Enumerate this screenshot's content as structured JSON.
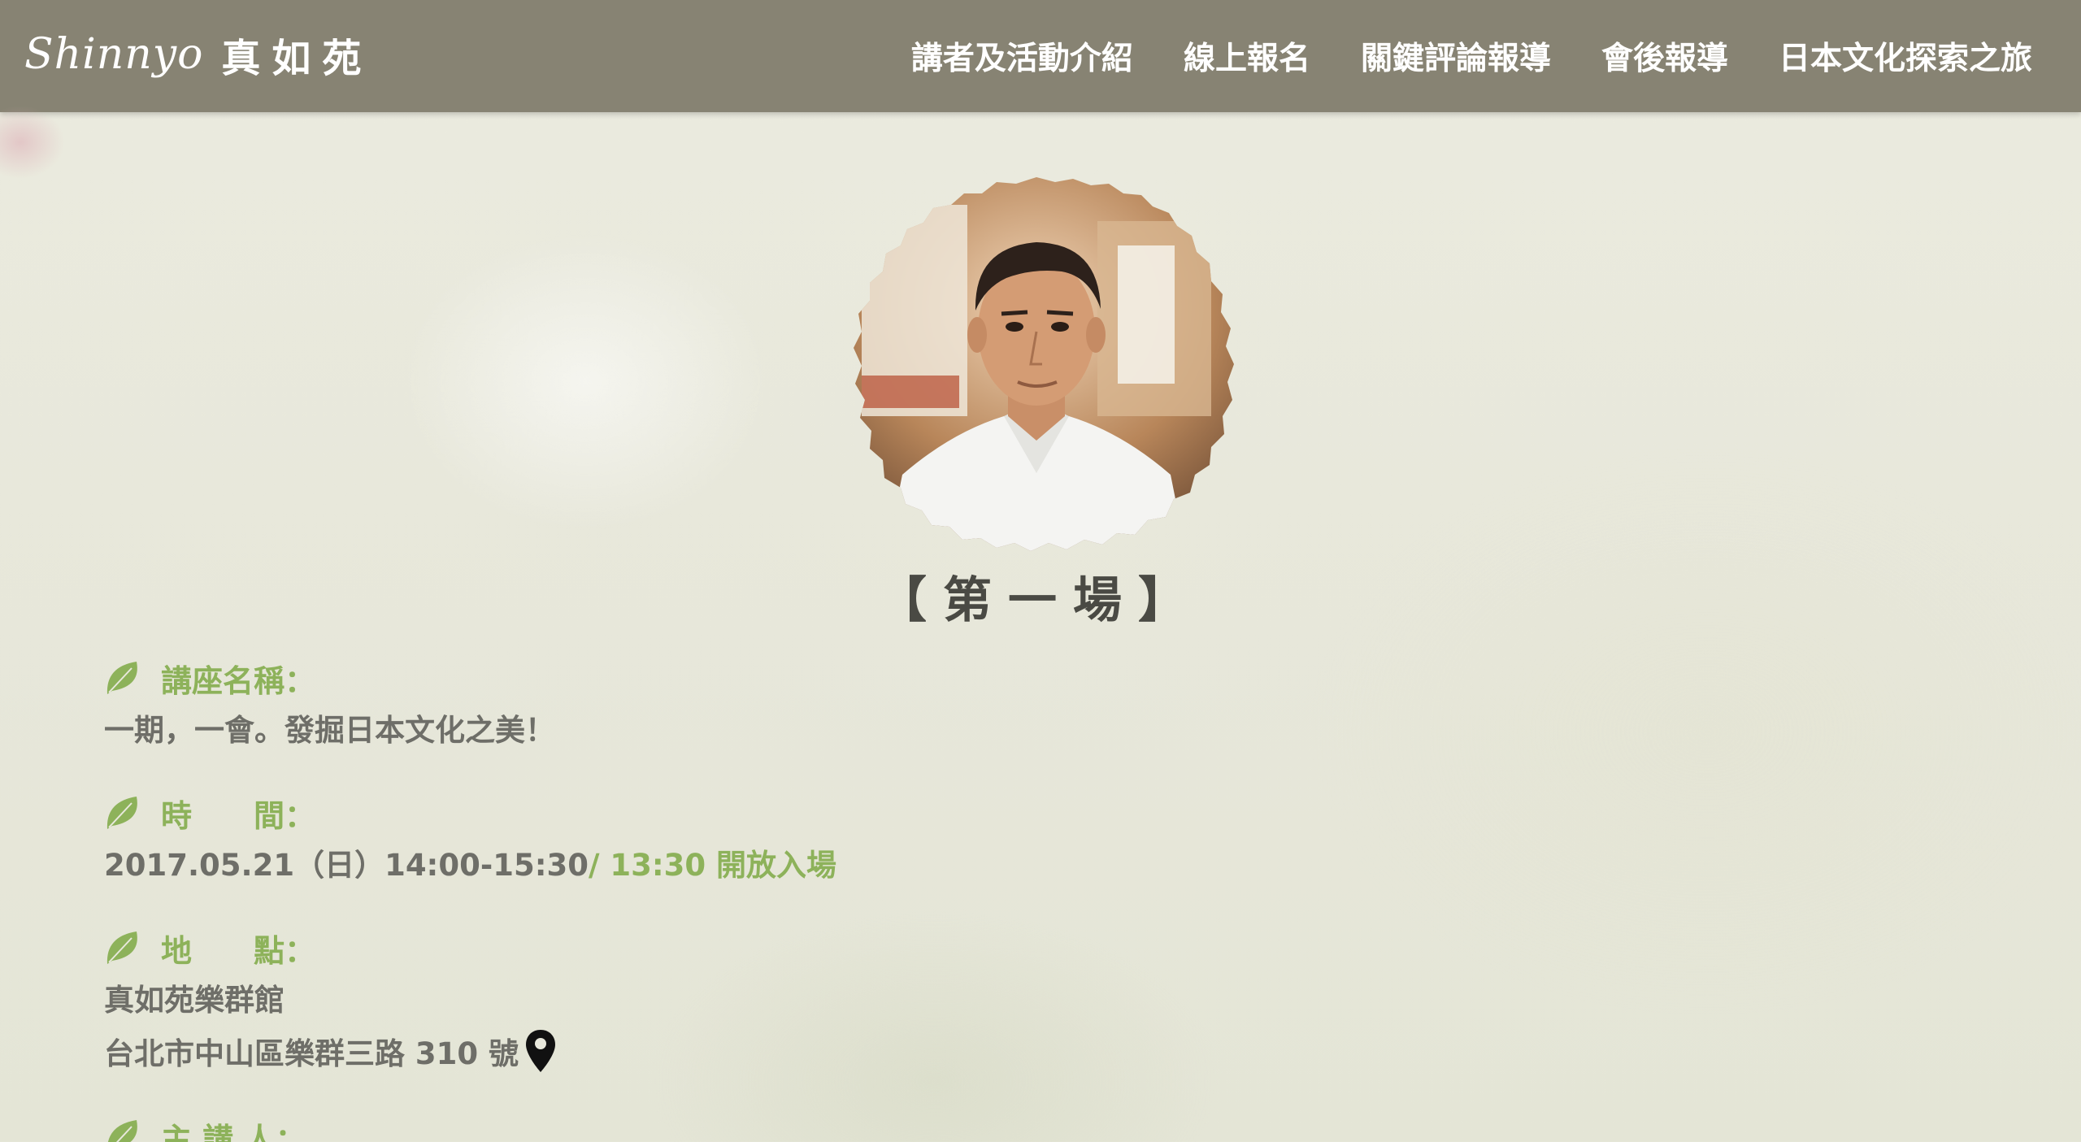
{
  "logo": {
    "script": "Shinnyo",
    "cjk": "真如苑"
  },
  "nav": {
    "items": [
      "講者及活動介紹",
      "線上報名",
      "關鍵評論報導",
      "會後報導",
      "日本文化探索之旅"
    ]
  },
  "session": {
    "title": "【第一場】"
  },
  "info": {
    "lecture_name": {
      "label": "講座名稱：",
      "value": "一期，一會。發掘日本文化之美！"
    },
    "time": {
      "label": "時　　間：",
      "value": "2017.05.21（日）14:00-15:30",
      "open": "/ 13:30 開放入場"
    },
    "location": {
      "label": "地　　點：",
      "venue": "真如苑樂群館",
      "address": "台北市中山區樂群三路 310 號"
    },
    "speaker": {
      "label": "主 講 人："
    }
  },
  "colors": {
    "navbar": "#878373",
    "accent_green": "#8db25a",
    "text_gray": "#6e6e68",
    "background": "#e8e8dc"
  },
  "icons": {
    "leaf": "leaf-icon",
    "location": "map-pin-icon"
  }
}
